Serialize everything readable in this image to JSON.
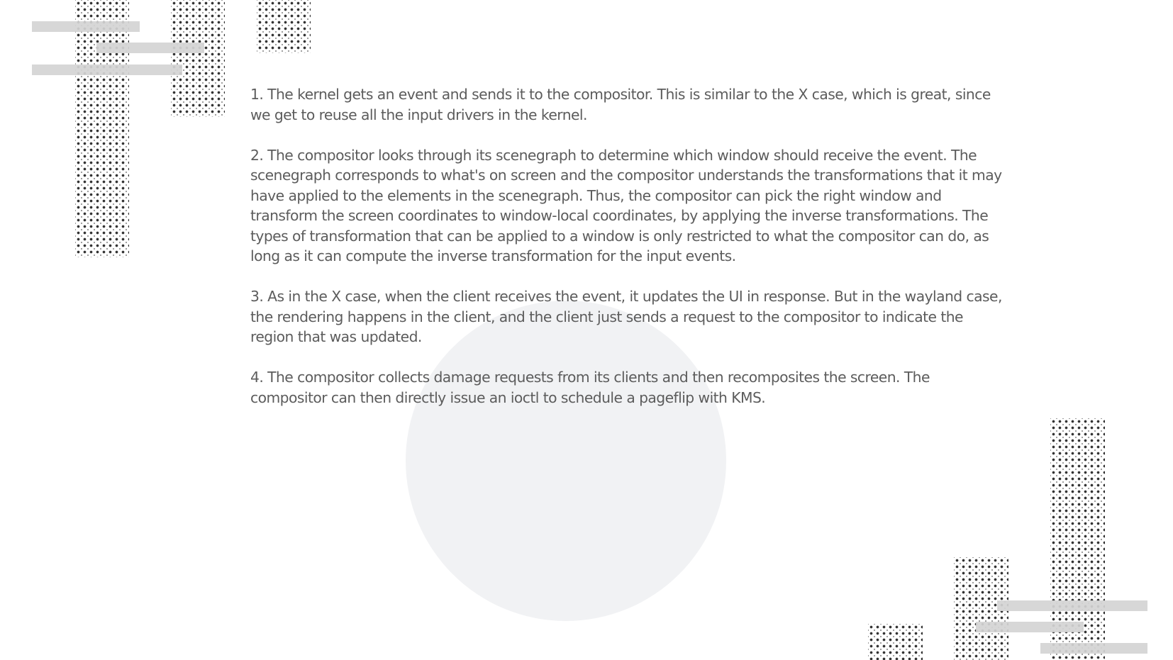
{
  "slide": {
    "paragraphs": [
      "1. The kernel gets an event and sends it to the compositor. This is similar to the X case, which is great, since we get to reuse all the input drivers in the kernel.",
      "2. The compositor looks through its scenegraph to determine which window should receive the event. The scenegraph corresponds to what's on screen and the compositor understands the transformations that it may have applied to the elements in the scenegraph. Thus, the compositor can pick the right window and transform the screen coordinates to window-local coordinates, by applying the inverse transformations. The types of transformation that can be applied to a window is only restricted to what the compositor can do, as long as it can compute the inverse transformation for the input events.",
      "3. As in the X case, when the client receives the event, it updates the UI in response. But in the wayland case, the rendering happens in the client, and the client just sends a request to the compositor to indicate the region that was updated.",
      "4. The compositor collects damage requests from its clients and then recomposites the screen. The compositor can then directly issue an ioctl to schedule a pageflip with KMS."
    ]
  },
  "colors": {
    "background": "#ffffff",
    "body_text": "#5c5c5c",
    "circle": "#f1f2f4",
    "bar": "#d4d4d4",
    "dots": "#1c1c1c"
  }
}
